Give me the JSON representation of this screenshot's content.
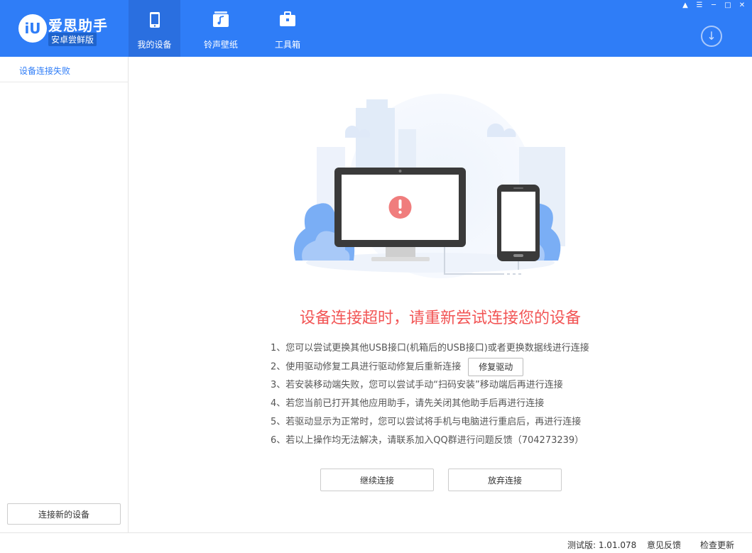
{
  "app": {
    "logo_text": "iU",
    "title": "爱思助手",
    "subtitle": "安卓尝鲜版"
  },
  "nav": {
    "tabs": [
      {
        "label": "我的设备"
      },
      {
        "label": "铃声壁纸"
      },
      {
        "label": "工具箱"
      }
    ]
  },
  "sidebar": {
    "items": [
      {
        "label": "设备连接失败"
      }
    ],
    "connect_new_label": "连接新的设备"
  },
  "main": {
    "headline": "设备连接超时，请重新尝试连接您的设备",
    "steps": [
      "1、您可以尝试更换其他USB接口(机箱后的USB接口)或者更换数据线进行连接",
      "2、使用驱动修复工具进行驱动修复后重新连接",
      "3、若安装移动端失败，您可以尝试手动“扫码安装”移动端后再进行连接",
      "4、若您当前已打开其他应用助手，请先关闭其他助手后再进行连接",
      "5、若驱动显示为正常时，您可以尝试将手机与电脑进行重启后，再进行连接",
      "6、若以上操作均无法解决，请联系加入QQ群进行问题反馈（704273239）"
    ],
    "repair_button": "修复驱动",
    "continue_button": "继续连接",
    "abandon_button": "放弃连接"
  },
  "statusbar": {
    "version": "测试版: 1.01.078",
    "feedback": "意见反馈",
    "check_update": "检查更新"
  },
  "colors": {
    "brand": "#2f7df7",
    "error": "#f25555"
  }
}
